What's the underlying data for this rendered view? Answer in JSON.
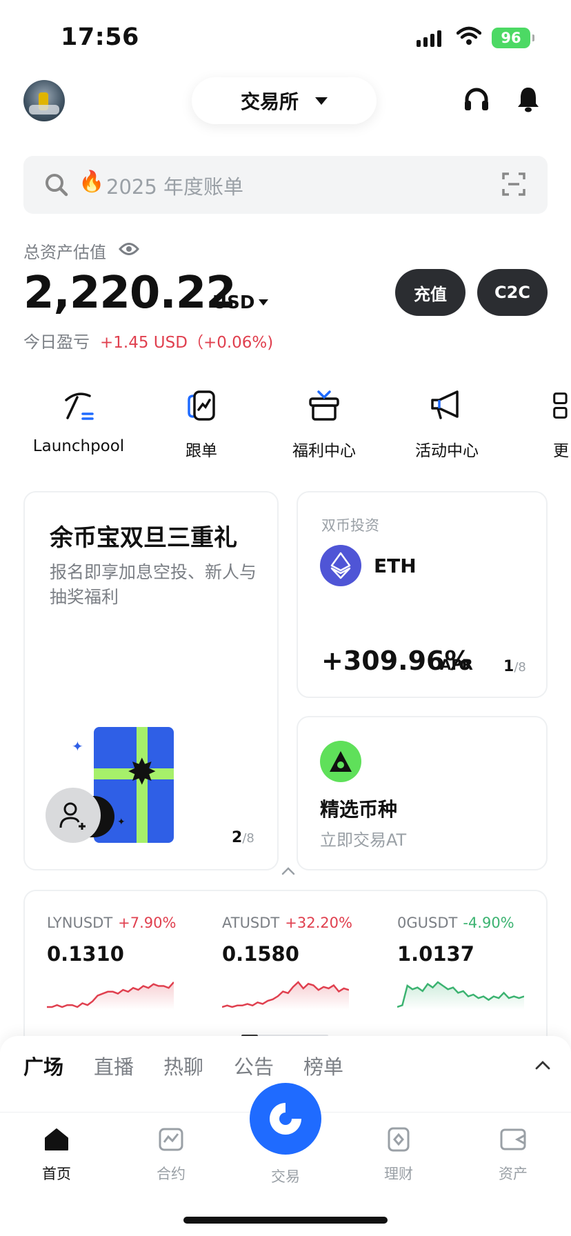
{
  "status_bar": {
    "time": "17:56",
    "battery": "96"
  },
  "header": {
    "exchange_label": "交易所"
  },
  "search": {
    "placeholder": "2025 年度账单",
    "fire_emoji": "🔥"
  },
  "assets": {
    "label": "总资产估值",
    "value": "2,220.22",
    "unit": "USD",
    "pnl_label": "今日盈亏",
    "pnl_value": "+1.45 USD（+0.06%)",
    "deposit_label": "充值",
    "c2c_label": "C2C"
  },
  "shortcuts": [
    {
      "label": "Launchpool",
      "icon": "pickaxe-icon"
    },
    {
      "label": "跟单",
      "icon": "copy-trade-icon"
    },
    {
      "label": "福利中心",
      "icon": "gift-icon"
    },
    {
      "label": "活动中心",
      "icon": "megaphone-icon"
    },
    {
      "label": "更",
      "icon": "more-grid-icon"
    }
  ],
  "promo": {
    "title": "余币宝双旦三重礼",
    "subtitle": "报名即享加息空投、新人与抽奖福利",
    "page": "2",
    "page_total": "/8"
  },
  "dual_invest": {
    "label": "双币投资",
    "coin": "ETH",
    "apr": "+309.96%",
    "apr_unit": "APR",
    "page": "1",
    "page_total": "/8"
  },
  "featured": {
    "title": "精选币种",
    "subtitle": "立即交易AT"
  },
  "market": [
    {
      "symbol": "LYNUSDT",
      "change": "+7.90%",
      "price": "0.1310",
      "trend": "up",
      "spark": [
        2,
        2,
        3,
        2,
        3,
        3,
        2,
        4,
        3,
        5,
        8,
        9,
        10,
        10,
        9,
        11,
        10,
        12,
        11,
        13,
        12,
        14,
        13,
        13,
        12,
        15
      ]
    },
    {
      "symbol": "ATUSDT",
      "change": "+32.20%",
      "price": "0.1580",
      "trend": "up",
      "spark": [
        2,
        3,
        2,
        3,
        3,
        4,
        3,
        5,
        4,
        6,
        7,
        9,
        12,
        11,
        15,
        18,
        14,
        17,
        16,
        13,
        15,
        14,
        16,
        12,
        14,
        13
      ]
    },
    {
      "symbol": "0GUSDT",
      "change": "-4.90%",
      "price": "1.0137",
      "trend": "down",
      "spark": [
        4,
        5,
        16,
        14,
        15,
        13,
        17,
        15,
        18,
        16,
        14,
        15,
        12,
        13,
        10,
        11,
        9,
        10,
        8,
        10,
        9,
        12,
        9,
        10,
        9,
        10
      ]
    }
  ],
  "feed_tabs": [
    "广场",
    "直播",
    "热聊",
    "公告",
    "榜单"
  ],
  "nav": {
    "home": "首页",
    "futures": "合约",
    "trade": "交易",
    "earn": "理财",
    "assets": "资产"
  },
  "colors": {
    "up": "#e0404f",
    "down": "#3cb371",
    "brand": "#1f6bff",
    "dark_button": "#2b2d31"
  }
}
